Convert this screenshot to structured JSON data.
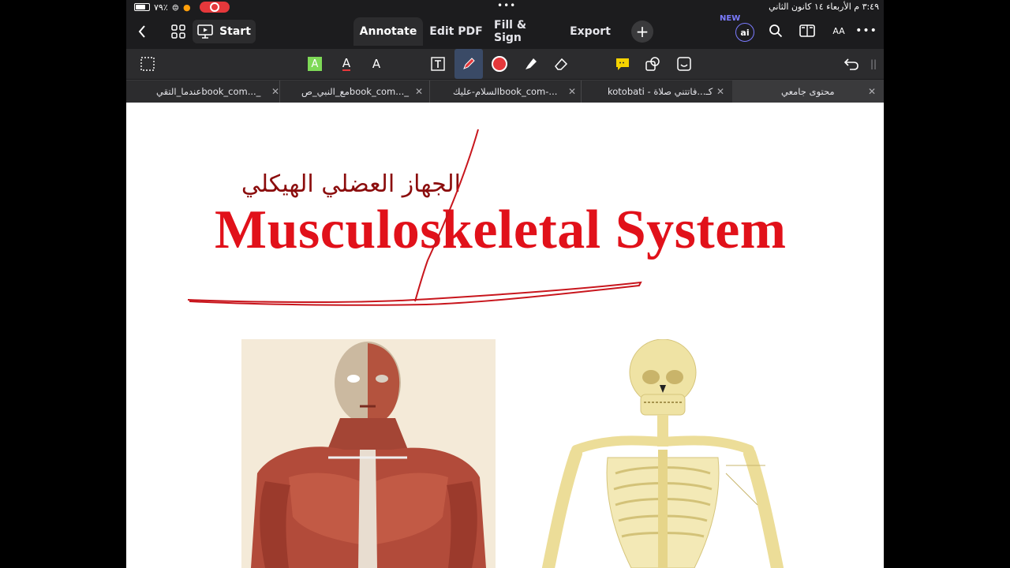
{
  "status_bar": {
    "time_date": "٣:٤٩ م  الأربعاء ١٤ كانون الثاني",
    "battery": "٧٩٪"
  },
  "toolbar": {
    "start_label": "Start",
    "modes": [
      "Annotate",
      "Edit PDF",
      "Fill & Sign",
      "Export"
    ],
    "active_mode": "Annotate",
    "new_badge": "NEW",
    "ai_label": "ai",
    "text_size_label": "AA"
  },
  "annotation_tools": {
    "accent": "#e5383b",
    "highlight_color": "#7ed957"
  },
  "tabs": [
    {
      "label": "عندما_التقيbook_com..._"
    },
    {
      "label": "مع_النبي_صbook_com..._"
    },
    {
      "label": "السلام-عليكbook_com-..."
    },
    {
      "label": "kotobati - كـ...فاتتني صلاة"
    },
    {
      "label": "محتوى جامعي",
      "active": true
    }
  ],
  "page": {
    "arabic_title": "الجهاز العضلي الهيكلي",
    "english_title": "Musculoskeletal System",
    "title_color": "#e1111a"
  }
}
